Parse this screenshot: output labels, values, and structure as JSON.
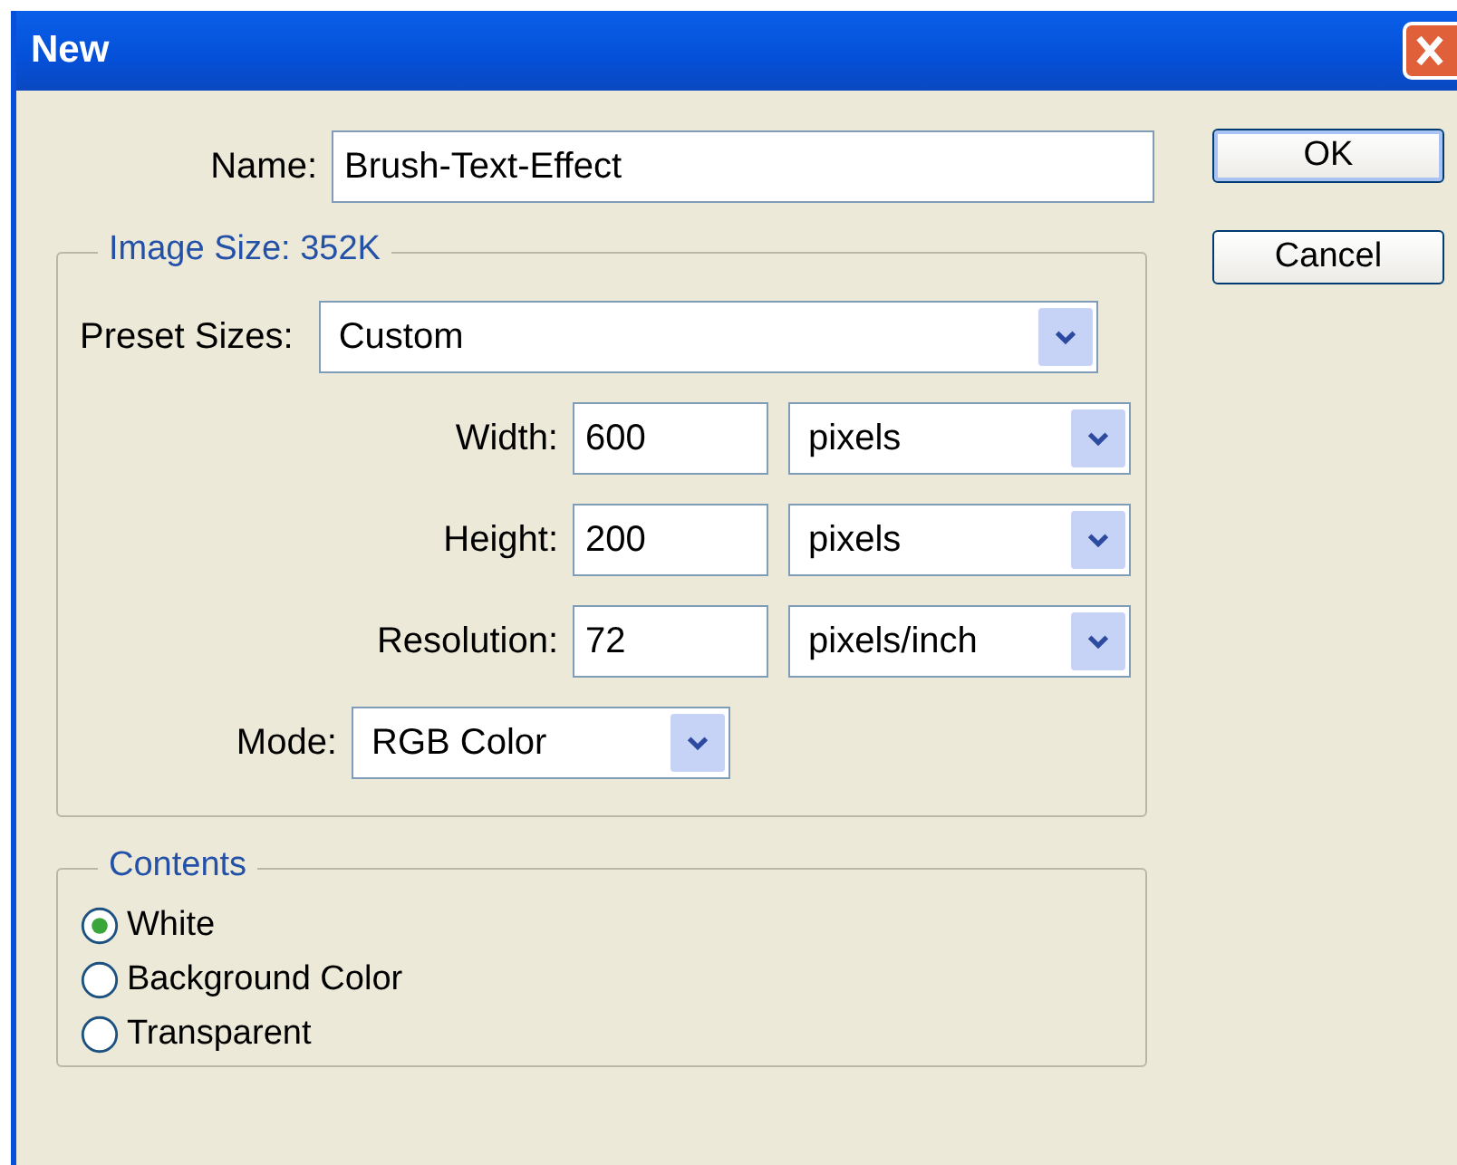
{
  "window": {
    "title": "New"
  },
  "name": {
    "label": "Name:",
    "value": "Brush-Text-Effect"
  },
  "buttons": [
    {
      "label": "OK",
      "default": true
    },
    {
      "label": "Cancel",
      "default": false
    }
  ],
  "image_size": {
    "legend": "Image Size: 352K",
    "fields": [
      {
        "kind": "preset",
        "label": "Preset Sizes:",
        "value": "Custom"
      },
      {
        "kind": "number",
        "label": "Width:",
        "value": "600",
        "unit": "pixels"
      },
      {
        "kind": "number",
        "label": "Height:",
        "value": "200",
        "unit": "pixels"
      },
      {
        "kind": "number",
        "label": "Resolution:",
        "value": "72",
        "unit": "pixels/inch"
      },
      {
        "kind": "mode",
        "label": "Mode:",
        "value": "RGB Color"
      }
    ]
  },
  "contents": {
    "legend": "Contents",
    "options": [
      {
        "label": "White",
        "selected": true
      },
      {
        "label": "Background Color",
        "selected": false
      },
      {
        "label": "Transparent",
        "selected": false
      }
    ]
  }
}
